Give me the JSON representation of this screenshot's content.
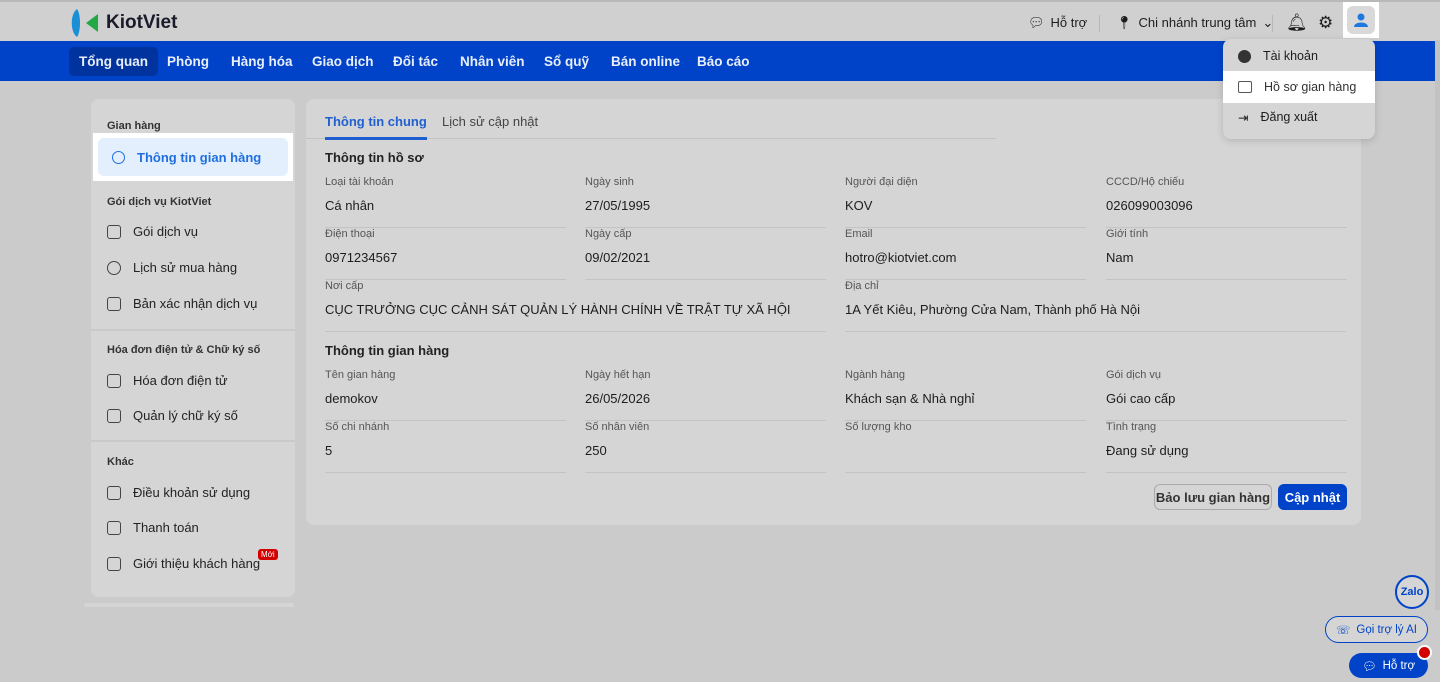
{
  "app": {
    "name": "KiotViet"
  },
  "topbar": {
    "support": "Hỗ trợ",
    "branch": "Chi nhánh trung tâm"
  },
  "nav": [
    "Tổng quan",
    "Phòng",
    "Hàng hóa",
    "Giao dịch",
    "Đối tác",
    "Nhân viên",
    "Sổ quỹ",
    "Bán online",
    "Báo cáo"
  ],
  "user_menu": [
    "Tài khoản",
    "Hồ sơ gian hàng",
    "Đăng xuất"
  ],
  "sidebar": {
    "g1": "Gian hàng",
    "g1_items": [
      "Thông tin gian hàng"
    ],
    "g2": "Gói dịch vụ KiotViet",
    "g2_items": [
      "Gói dịch vụ",
      "Lịch sử mua hàng",
      "Bản xác nhận dịch vụ"
    ],
    "g3": "Hóa đơn điện tử & Chữ ký số",
    "g3_items": [
      "Hóa đơn điện tử",
      "Quản lý chữ ký số"
    ],
    "g4": "Khác",
    "g4_items": [
      "Điều khoản sử dụng",
      "Thanh toán",
      "Giới thiệu khách hàng"
    ],
    "new_badge": "Mới"
  },
  "tabs": [
    "Thông tin chung",
    "Lịch sử cập nhật"
  ],
  "profile": {
    "title": "Thông tin hồ sơ",
    "fields": [
      {
        "label": "Loại tài khoản",
        "value": "Cá nhân"
      },
      {
        "label": "Ngày sinh",
        "value": "27/05/1995"
      },
      {
        "label": "Người đại diện",
        "value": "KOV"
      },
      {
        "label": "CCCD/Hộ chiếu",
        "value": "026099003096"
      },
      {
        "label": "Điện thoại",
        "value": "0971234567"
      },
      {
        "label": "Ngày cấp",
        "value": "09/02/2021"
      },
      {
        "label": "Email",
        "value": "hotro@kiotviet.com"
      },
      {
        "label": "Giới tính",
        "value": "Nam"
      },
      {
        "label": "Nơi cấp",
        "value": "CỤC TRƯỞNG CỤC CẢNH SÁT QUẢN LÝ HÀNH CHÍNH VỀ TRẬT TỰ XÃ HỘI"
      },
      {
        "label": "Địa chỉ",
        "value": "1A Yết Kiêu, Phường Cửa Nam, Thành phố Hà Nội"
      }
    ]
  },
  "store": {
    "title": "Thông tin gian hàng",
    "fields": [
      {
        "label": "Tên gian hàng",
        "value": "demokov"
      },
      {
        "label": "Ngày hết hạn",
        "value": "26/05/2026"
      },
      {
        "label": "Ngành hàng",
        "value": "Khách sạn & Nhà nghỉ"
      },
      {
        "label": "Gói dịch vụ",
        "value": "Gói cao cấp"
      },
      {
        "label": "Số chi nhánh",
        "value": "5"
      },
      {
        "label": "Số nhân viên",
        "value": "250"
      },
      {
        "label": "Số lượng kho",
        "value": ""
      },
      {
        "label": "Tình trạng",
        "value": "Đang sử dụng"
      }
    ]
  },
  "actions": {
    "backup": "Bảo lưu gian hàng",
    "update": "Cập nhật"
  },
  "floating": {
    "zalo": "Zalo",
    "ai": "Gọi trợ lý AI",
    "support": "Hỗ trợ"
  }
}
